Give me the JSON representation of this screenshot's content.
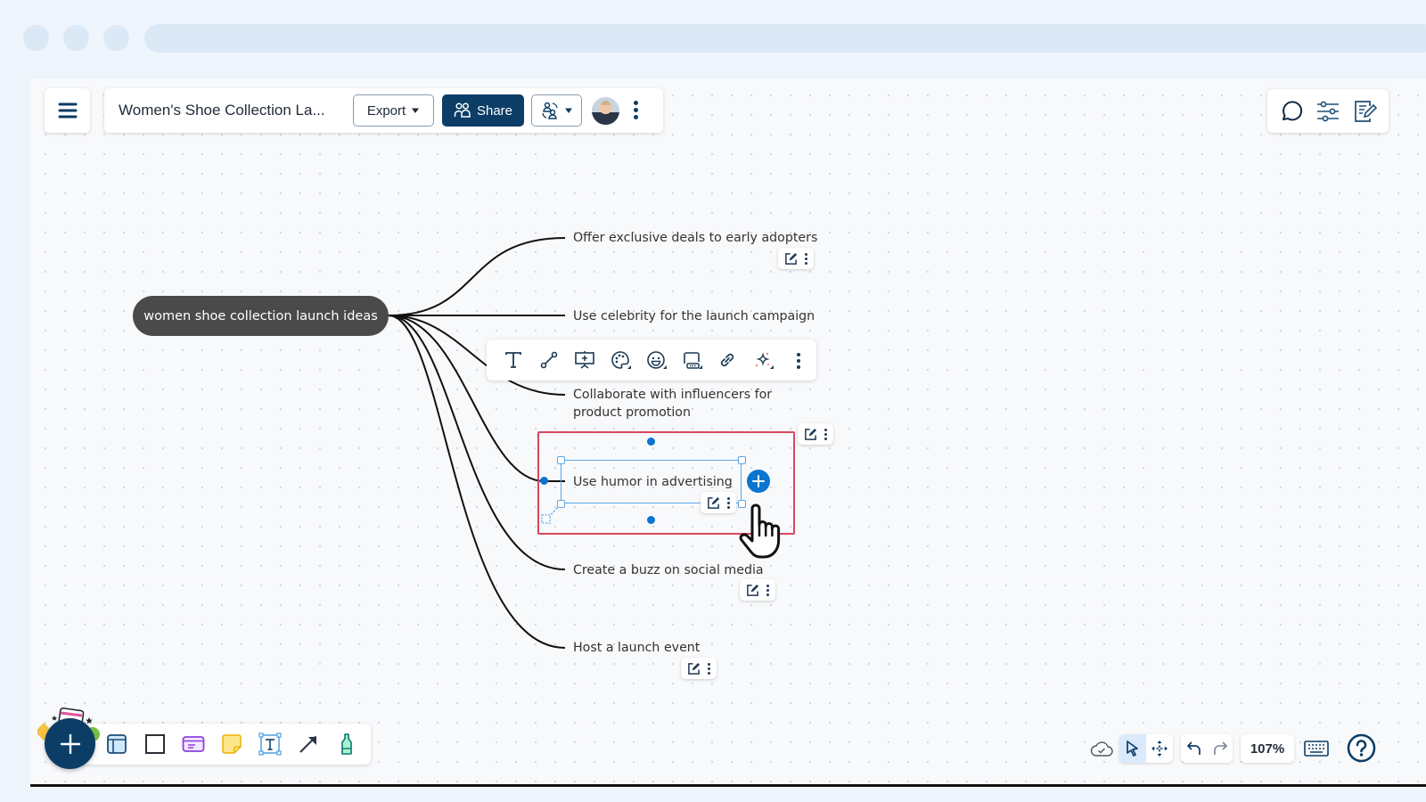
{
  "header": {
    "doc_title": "Women's Shoe Collection La...",
    "export_label": "Export",
    "share_label": "Share"
  },
  "icons": {
    "menu": "hamburger-menu-icon",
    "share": "users-icon",
    "collab": "collaborators-icon",
    "more": "kebab-icon",
    "comment": "comment-icon",
    "settings": "sliders-icon",
    "notes": "notes-icon"
  },
  "mindmap": {
    "root": "women shoe collection launch ideas",
    "children": [
      {
        "label": "Offer exclusive deals to early adopters"
      },
      {
        "label": "Use celebrity for the launch campaign"
      },
      {
        "label": "Collaborate with influencers for product promotion"
      },
      {
        "label": "Use humor in advertising",
        "selected": true
      },
      {
        "label": "Create a buzz on social media"
      },
      {
        "label": "Host a launch event"
      }
    ]
  },
  "context_toolbar": {
    "items": [
      "text",
      "connector",
      "presentation-add",
      "color-palette",
      "emoji",
      "shape-style",
      "link",
      "ai-sparkle",
      "more"
    ]
  },
  "bottom_toolbar": {
    "items": [
      "add",
      "frame",
      "rectangle",
      "card",
      "sticky-note",
      "text-box",
      "arrow",
      "marker"
    ]
  },
  "status": {
    "zoom": "107%",
    "saved": "cloud-saved"
  },
  "colors": {
    "brand": "#0b3d66",
    "selection": "#d8475b",
    "accent": "#0a74cf",
    "root_node": "#4a4a4a"
  }
}
